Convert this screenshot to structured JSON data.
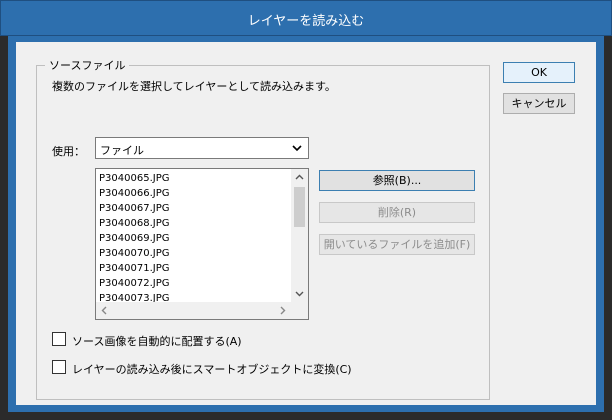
{
  "window": {
    "title": "レイヤーを読み込む"
  },
  "source_group": {
    "legend": "ソースファイル",
    "description": "複数のファイルを選択してレイヤーとして読み込みます。",
    "use_label": "使用：",
    "use_select_value": "ファイル",
    "files": [
      "P3040065.JPG",
      "P3040066.JPG",
      "P3040067.JPG",
      "P3040068.JPG",
      "P3040069.JPG",
      "P3040070.JPG",
      "P3040071.JPG",
      "P3040072.JPG",
      "P3040073.JPG"
    ],
    "browse_label": "参照(B)...",
    "delete_label": "削除(R)",
    "add_open_label": "開いているファイルを追加(F)"
  },
  "buttons": {
    "ok": "OK",
    "cancel": "キャンセル"
  },
  "options": {
    "auto_align_label": "ソース画像を自動的に配置する(A)",
    "auto_align_checked": false,
    "smart_object_label": "レイヤーの読み込み後にスマートオブジェクトに変換(C)",
    "smart_object_checked": false
  },
  "colors": {
    "title_bar": "#2d6fae",
    "dialog_bg": "#f0f0f0",
    "default_button_border": "#3c7fb1"
  },
  "icons": [
    "chevron-down-icon",
    "scroll-up-arrow-icon",
    "scroll-down-arrow-icon",
    "scroll-left-arrow-icon",
    "scroll-right-arrow-icon"
  ]
}
